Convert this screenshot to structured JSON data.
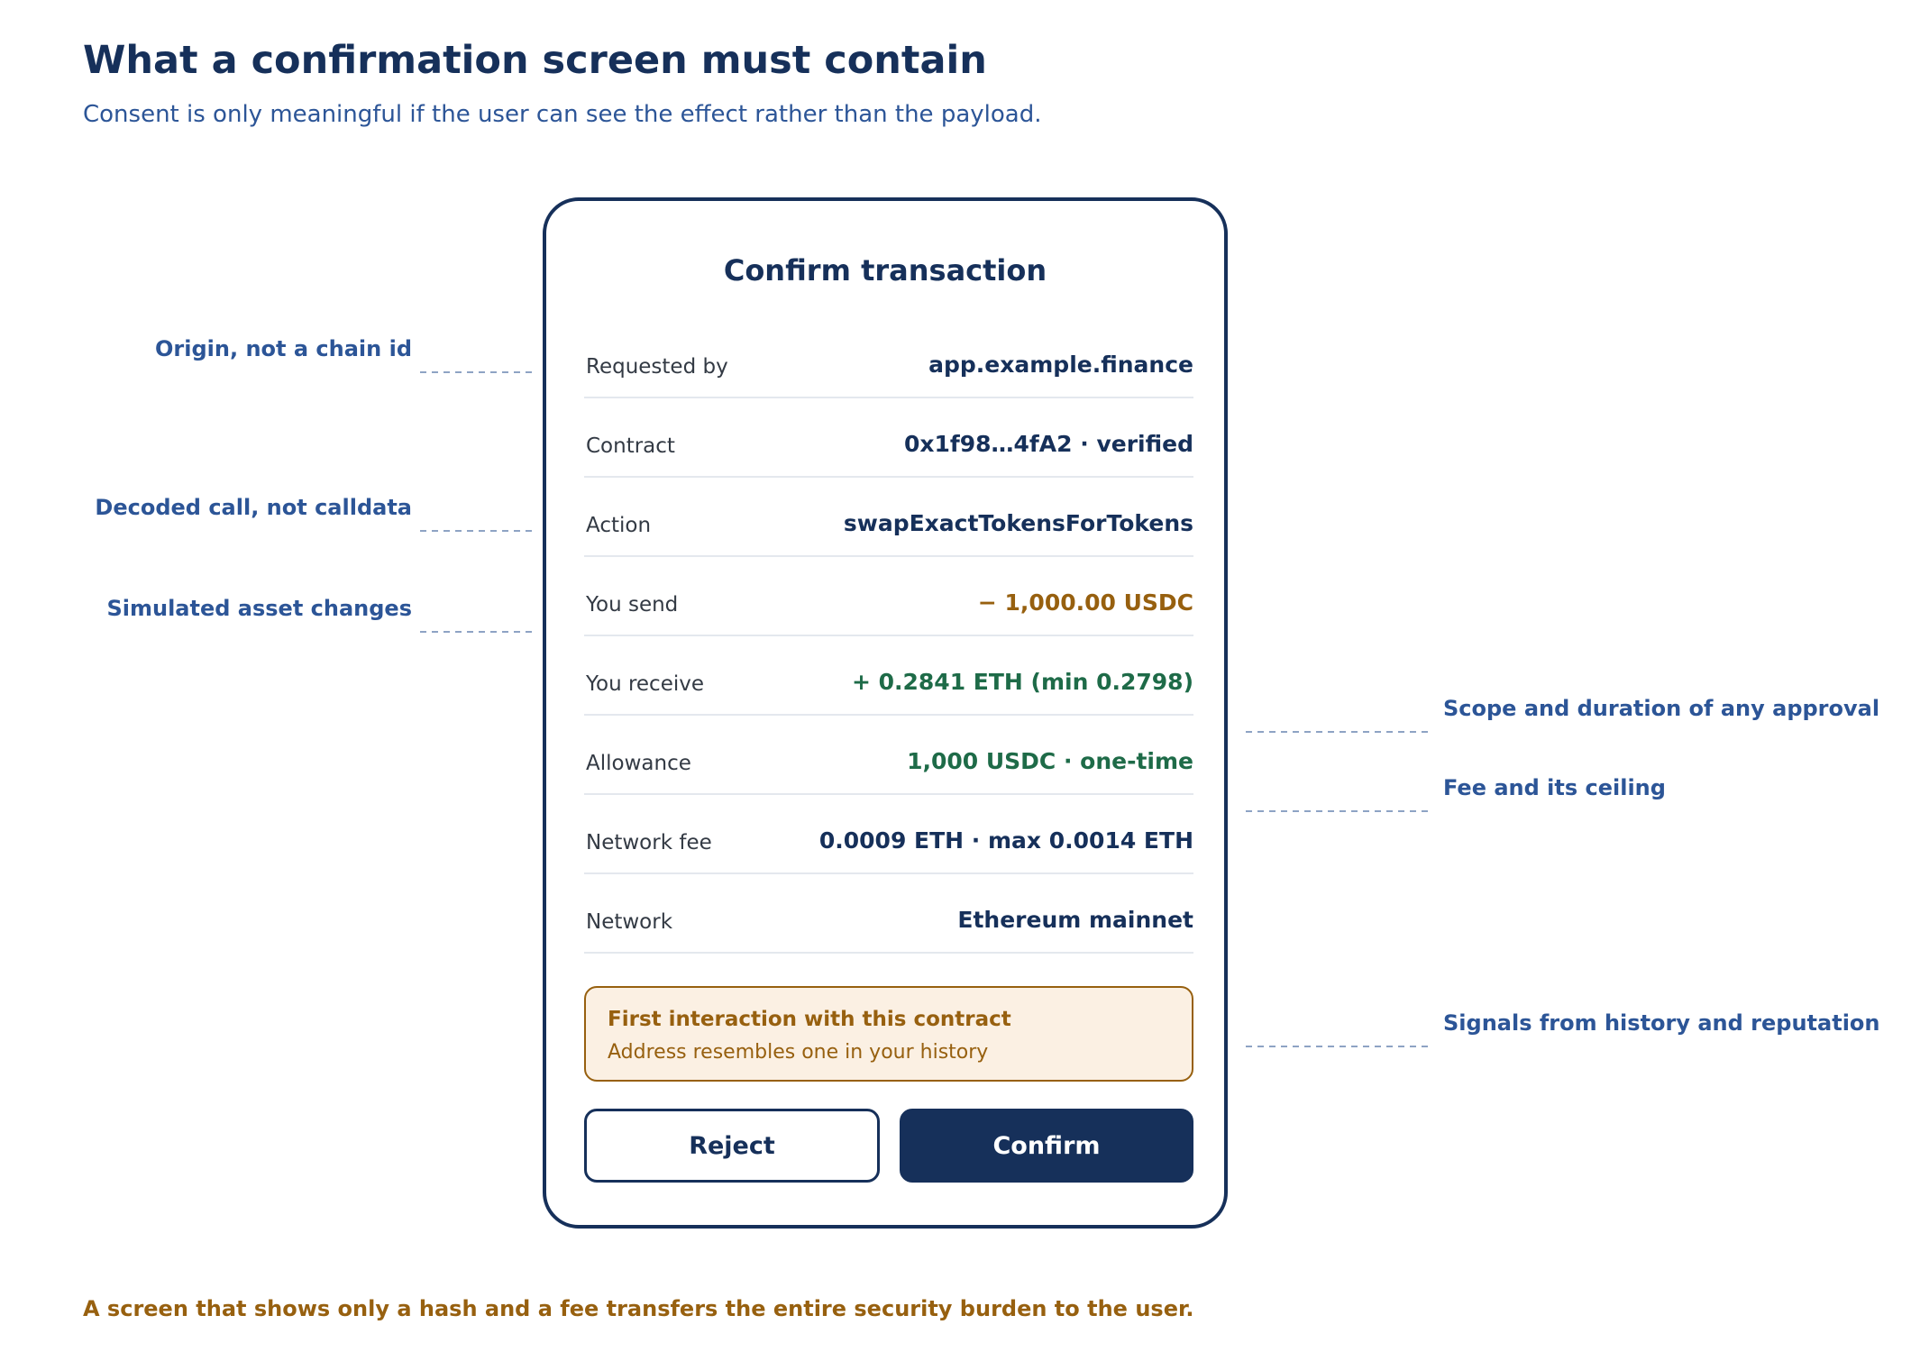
{
  "title": "What a confirmation screen must contain",
  "subtitle": "Consent is only meaningful if the user can see the effect rather than the payload.",
  "card": {
    "title": "Confirm transaction",
    "rows": [
      {
        "label": "Requested by",
        "value": "app.example.finance",
        "tone": "neutral"
      },
      {
        "label": "Contract",
        "value": "0x1f98…4fA2 · verified",
        "tone": "neutral"
      },
      {
        "label": "Action",
        "value": "swapExactTokensForTokens",
        "tone": "neutral"
      },
      {
        "label": "You send",
        "value": "− 1,000.00 USDC",
        "tone": "send"
      },
      {
        "label": "You receive",
        "value": "+ 0.2841 ETH (min 0.2798)",
        "tone": "receive"
      },
      {
        "label": "Allowance",
        "value": "1,000 USDC · one-time",
        "tone": "receive"
      },
      {
        "label": "Network fee",
        "value": "0.0009 ETH · max 0.0014 ETH",
        "tone": "neutral"
      },
      {
        "label": "Network",
        "value": "Ethereum mainnet",
        "tone": "neutral"
      }
    ],
    "warning": {
      "title": "First interaction with this contract",
      "detail": "Address resembles one in your history"
    },
    "reject_label": "Reject",
    "confirm_label": "Confirm"
  },
  "annotations": {
    "left": [
      "Origin, not a chain id",
      "Decoded call, not calldata",
      "Simulated asset changes"
    ],
    "right": [
      "Scope and duration of any approval",
      "Fee and its ceiling",
      "Signals from history and reputation"
    ]
  },
  "footer": "A screen that shows only a hash and a fee transfers the entire security burden to the user.",
  "colors": {
    "navy": "#16305a",
    "blue": "#2c5597",
    "amber": "#97600f",
    "green": "#1e6b48",
    "warning_bg": "#fbf0e3",
    "divider": "#e4e8ee",
    "connector": "#8ea3c4"
  }
}
